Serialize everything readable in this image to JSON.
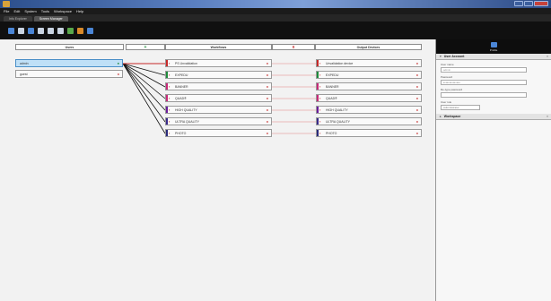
{
  "window": {
    "title": ""
  },
  "menu": {
    "items": [
      "File",
      "Edit",
      "System",
      "Tools",
      "Workspace",
      "Help"
    ]
  },
  "tabs": [
    {
      "label": "Info Explorer"
    },
    {
      "label": "Screen Manager"
    }
  ],
  "toolbar": {
    "icons": [
      "add-user-icon",
      "user-settings-icon",
      "workflow-icon",
      "device-icon",
      "server-icon",
      "list-icon",
      "grid-icon",
      "chart-icon",
      "layout-icon"
    ]
  },
  "columns": {
    "users": "Users",
    "workflows": "Workflows",
    "output_devices": "Output Devices",
    "add_symbol": "+",
    "delete_symbol": "x"
  },
  "users": [
    {
      "label": "admin"
    },
    {
      "label": "guest"
    }
  ],
  "workflows": [
    {
      "label": "PS Unvalidation",
      "color": "#c62828"
    },
    {
      "label": "EXPEDU",
      "color": "#1e8a3a"
    },
    {
      "label": "BANNER",
      "color": "#c62878"
    },
    {
      "label": "QUAD®",
      "color": "#c62878"
    },
    {
      "label": "HIGH QUALITY",
      "color": "#6a1b9a"
    },
    {
      "label": "ULTRA QUALITY",
      "color": "#3a2a8a"
    },
    {
      "label": "PHOTO",
      "color": "#2a2a7a"
    }
  ],
  "devices": [
    {
      "label": "Unvalidation device",
      "color": "#c62828"
    },
    {
      "label": "EXPEDU",
      "color": "#1e8a3a"
    },
    {
      "label": "BANNER",
      "color": "#c62878"
    },
    {
      "label": "QUAD®",
      "color": "#c62878"
    },
    {
      "label": "HIGH QUALITY",
      "color": "#6a1b9a"
    },
    {
      "label": "ULTRA QUALITY",
      "color": "#3a2a8a"
    },
    {
      "label": "PHOTO",
      "color": "#2a2a7a"
    }
  ],
  "sidebar": {
    "header_label": "Profile",
    "user_account": {
      "title": "User Account",
      "username_label": "User name",
      "username_value": "admin",
      "password_label": "Password",
      "password_value": "••••••••••••••",
      "retype_label": "Re-type password",
      "retype_value": "",
      "role_label": "User role",
      "role_value": "Administrator"
    },
    "workspace": {
      "title": "Workspace"
    }
  }
}
